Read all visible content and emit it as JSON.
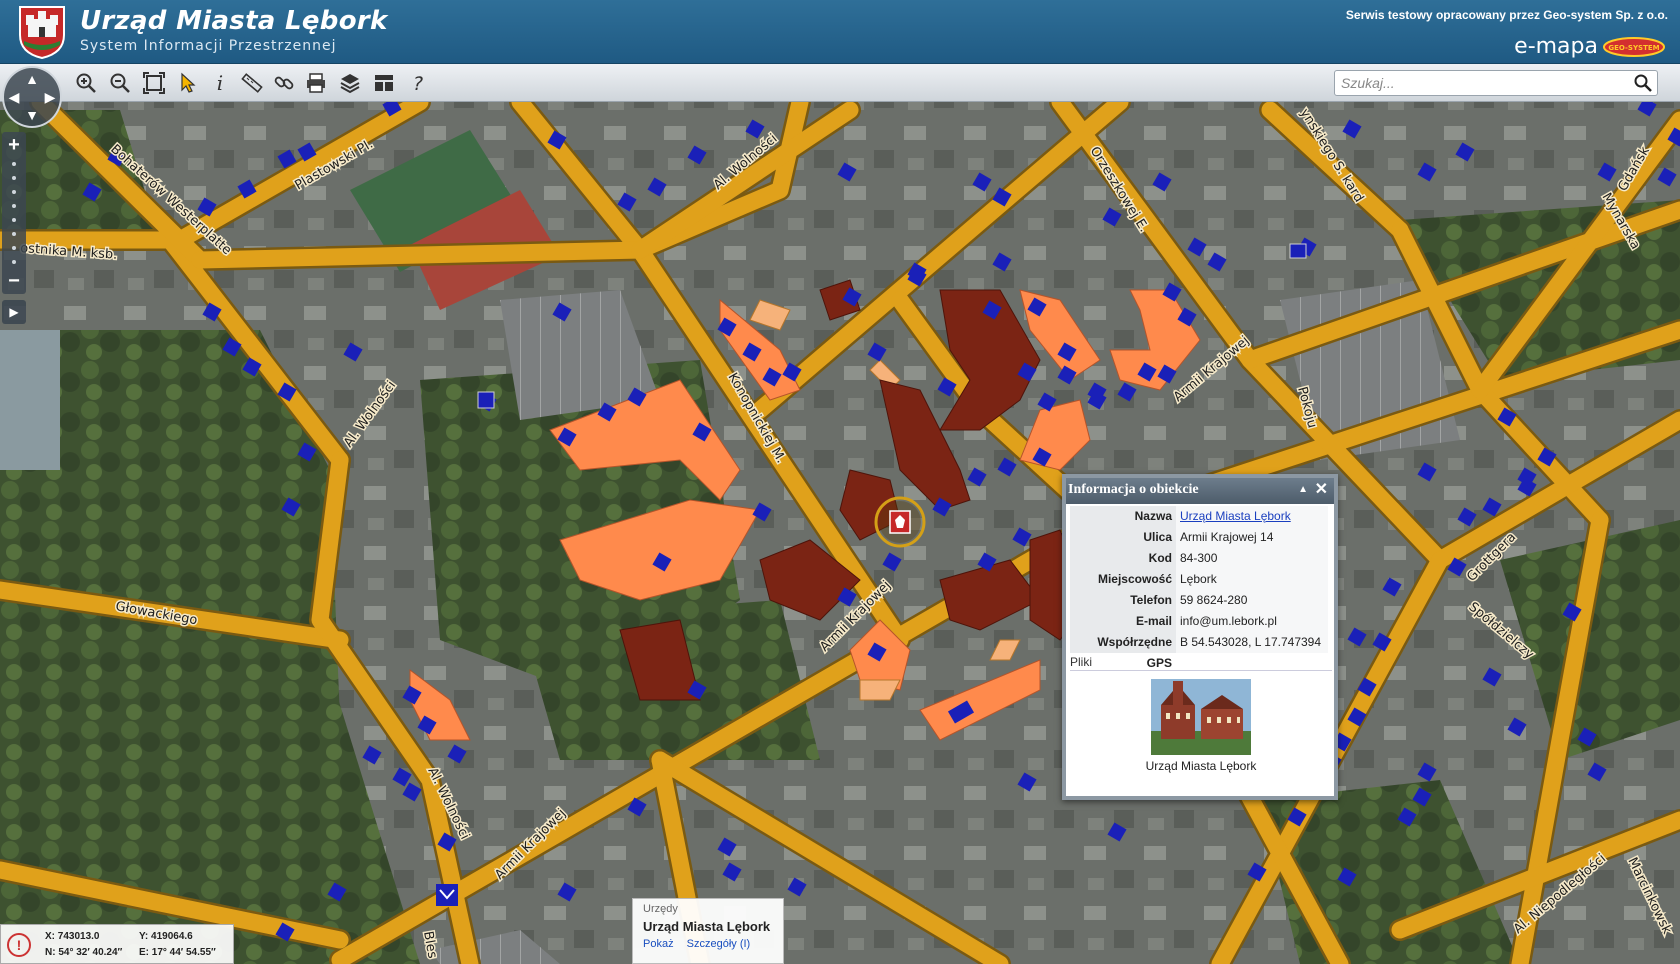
{
  "header": {
    "title": "Urząd Miasta Lębork",
    "subtitle": "System Informacji Przestrzennej",
    "service_note": "Serwis testowy opracowany przez Geo-system Sp. z o.o.",
    "brand": "e-mapa",
    "brand_logo_text": "GEO-SYSTEM"
  },
  "toolbar": {
    "tools": [
      "zoom-in-icon",
      "zoom-out-icon",
      "zoom-extent-icon",
      "select-pointer-icon",
      "info-icon",
      "measure-icon",
      "link-icon",
      "print-icon",
      "layers-icon",
      "layout-icon",
      "help-icon"
    ],
    "search_placeholder": "Szukaj..."
  },
  "nav": {
    "up": "▲",
    "down": "▼",
    "left": "◀",
    "right": "▶",
    "zoom_in": "+",
    "zoom_out": "−",
    "panel_toggle": "▶"
  },
  "map_labels": {
    "plastowski": "Plastowski Pl.",
    "wolnosci_top": "Al. Wolności",
    "bohaterow": "Bohaterów Westerplatte",
    "ostnika": "ostnika M. ksb.",
    "wolnosci_left": "Al. Wolności",
    "konopnickiej": "Konopnickiej M.",
    "orzeszkowej": "Orzeszkowej E.",
    "kard": "ynskiego S. kard",
    "armii_krajowej_right": "Armii Krajowej",
    "armii_krajowej_mid": "Armii Krajowej",
    "armii_krajowej_bottom": "Armii Krajowej",
    "glowackiego": "Głowackiego",
    "pokoju": "Pokoju",
    "grottgera": "Grottgera",
    "spoldzielczy": "Spółdzielczy",
    "mynarska": "Mynarska",
    "gdanska": "Gdańsk",
    "wolnosci_bottom": "Al. Wolności",
    "niepodleglosci": "Al. Niepodległości",
    "marcinkowsk": "Marcinkowsk",
    "bles": "Bles"
  },
  "popup": {
    "title": "Informacja o obiekcie",
    "collapse": "▲",
    "close": "✕",
    "rows": [
      {
        "key": "Nazwa",
        "value": "Urząd Miasta Lębork"
      },
      {
        "key": "Ulica",
        "value": "Armii Krajowej 14"
      },
      {
        "key": "Kod",
        "value": "84-300"
      },
      {
        "key": "Miejscowość",
        "value": "Lębork"
      },
      {
        "key": "Telefon",
        "value": "59 8624-280"
      },
      {
        "key": "E-mail",
        "value": "info@um.lebork.pl"
      },
      {
        "key": "Współrzędne GPS",
        "value": "B 54.543028, L 17.747394"
      }
    ],
    "files_label": "Pliki",
    "photo_caption": "Urząd Miasta Lębork"
  },
  "feature_card": {
    "category": "Urzędy",
    "name": "Urząd Miasta Lębork",
    "show_link": "Pokaż",
    "details_link": "Szczegóły (I)"
  },
  "coords": {
    "icon": "!",
    "x": "X: 743013.0",
    "y": "Y: 419064.6",
    "n": "N: 54° 32′ 40.24″",
    "e": "E: 17° 44′ 54.55″"
  },
  "colors": {
    "road": "#e0a11b",
    "road_edge": "#8a6410",
    "building_orange": "#ff8a4c",
    "building_brown": "#7b2414",
    "number_badge": "#1a20b8",
    "accent_header": "#2a6891"
  }
}
